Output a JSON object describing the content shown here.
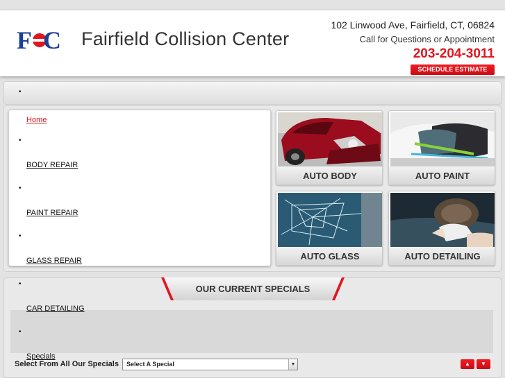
{
  "header": {
    "site_title": "Fairfield Collision Center",
    "address": "102 Linwood Ave, Fairfield, CT, 06824",
    "call_text": "Call for Questions or Appointment",
    "phone": "203-204-3011",
    "schedule_label": "SCHEDULE ESTIMATE"
  },
  "nav": {
    "top_bullet": "•",
    "items": [
      {
        "label": "Home",
        "bullet": ""
      },
      {
        "label": "BODY REPAIR",
        "bullet": "•"
      },
      {
        "label": "PAINT REPAIR",
        "bullet": "•"
      },
      {
        "label": "GLASS REPAIR",
        "bullet": "•"
      },
      {
        "label": "CAR DETAILING",
        "bullet": "•"
      },
      {
        "label": "Specials",
        "bullet": "•"
      }
    ]
  },
  "services": [
    {
      "label": "AUTO BODY",
      "icon": "car-damage-photo"
    },
    {
      "label": "AUTO PAINT",
      "icon": "paint-booth-photo"
    },
    {
      "label": "AUTO GLASS",
      "icon": "cracked-glass-photo"
    },
    {
      "label": "AUTO DETAILING",
      "icon": "polishing-photo"
    }
  ],
  "specials": {
    "title": "OUR CURRENT SPECIALS",
    "select_label": "Select From All Our Specials",
    "select_value": "Select A Special",
    "up_label": "▲",
    "down_label": "▼"
  },
  "colors": {
    "brand_red": "#e1161f",
    "brand_blue": "#1b3f93"
  }
}
